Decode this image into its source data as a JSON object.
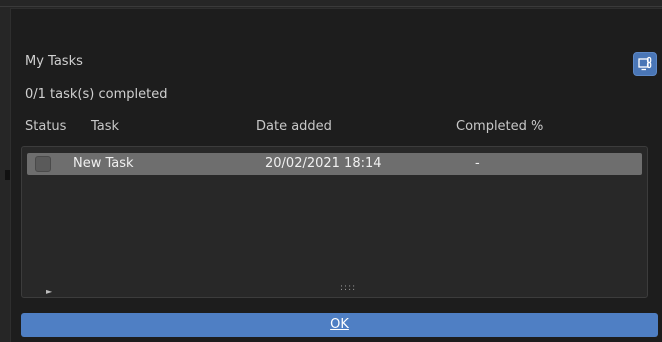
{
  "dialog": {
    "title": "My Tasks",
    "summary": "0/1 task(s) completed"
  },
  "columns": {
    "status": "Status",
    "task": "Task",
    "date_added": "Date added",
    "completed": "Completed %"
  },
  "tasks": [
    {
      "name": "New Task",
      "date_added": "20/02/2021 18:14",
      "completed": "-",
      "checked": false
    }
  ],
  "list": {
    "expand_glyph": "►",
    "grip_glyph": "::::"
  },
  "buttons": {
    "ok_label": "OK",
    "corner_icon": "copy-link-icon"
  },
  "colors": {
    "accent": "#4f7fc4",
    "row_selected": "#6e6e6e",
    "dialog_bg": "#1d1d1d"
  }
}
